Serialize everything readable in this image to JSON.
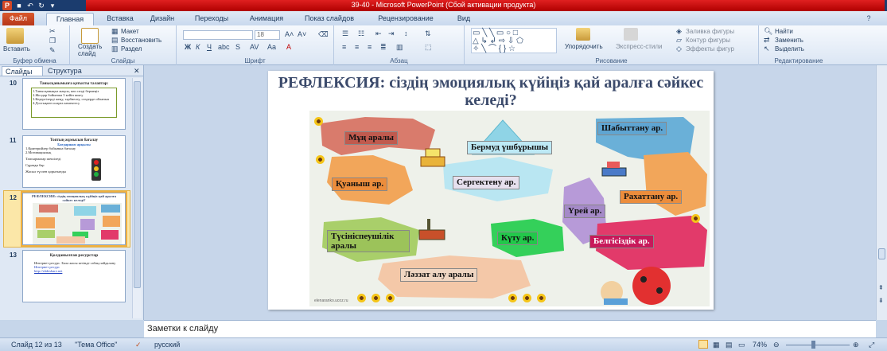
{
  "window": {
    "title": "39-40  -  Microsoft PowerPoint (Сбой активации продукта)"
  },
  "tabs": [
    "Файл",
    "Главная",
    "Вставка",
    "Дизайн",
    "Переходы",
    "Анимация",
    "Показ слайдов",
    "Рецензирование",
    "Вид"
  ],
  "ribbon": {
    "clipboard": {
      "paste": "Вставить",
      "label": "Буфер обмена"
    },
    "slides": {
      "new_slide": "Создать слайд",
      "layout": "Макет",
      "reset": "Восстановить",
      "section": "Раздел",
      "label": "Слайды"
    },
    "font": {
      "size": "18",
      "label": "Шрифт"
    },
    "paragraph": {
      "label": "Абзац"
    },
    "drawing": {
      "arrange": "Упорядочить",
      "quick_styles": "Экспресс-стили",
      "fill": "Заливка фигуры",
      "outline": "Контур фигуры",
      "effects": "Эффекты фигур",
      "label": "Рисование"
    },
    "editing": {
      "find": "Найти",
      "replace": "Заменить",
      "select": "Выделить",
      "label": "Редактирование"
    }
  },
  "panel": {
    "tabs": [
      "Слайды",
      "Структура"
    ],
    "slides": [
      {
        "num": "10",
        "title": "Танысқанымызға қатысты талаптар:",
        "lines": [
          "1.Танысқаныңыз жақсы, көп сөзді бермеңіз",
          "2.Жолдар бойынша 3 кейін шығу",
          "3.Кедергілерді жеңу, тәрбиелеу, сөздерде ойланып",
          "4.Достықпен оларға көмектесу"
        ]
      },
      {
        "num": "11",
        "title": "Топтың жұмысын бағалау",
        "subtitle": "Бағдаршам арқылы",
        "lines": [
          "1.Критерийлер бойынша бағалау",
          "2.Мотивациялық",
          "Тапсырмалар шешіледі",
          "Сұраққа бар",
          "Жасыл түспен қорытынды"
        ]
      },
      {
        "num": "12",
        "title": "РЕФЛЕКСИЯ: сіздің эмоциялық күйіңіз қай аралға сәйкес келеді?"
      },
      {
        "num": "13",
        "title": "Қолданылған ресурстар",
        "lines": [
          "Интернет ресурс. Бала жасы кезінде сабақ пайдалану",
          "Интернет ресурс",
          "http://slideshare.net"
        ]
      }
    ]
  },
  "slide": {
    "title": "РЕФЛЕКСИЯ: сіздің эмоциялық күйіңіз қай аралға сәйкес келеді?",
    "islands": {
      "mun": "Мұң аралы",
      "bermud": "Бермуд үшбұрышы",
      "shabyt": "Шабыттану ар.",
      "quanysh": "Қуаныш ар.",
      "sergek": "Сергектену ар.",
      "rakhat": "Рахаттану ар.",
      "urei": "Үрей ар.",
      "tusinis": "Түсініспеушілік аралы",
      "kutu": "Күту ар.",
      "belgisiz": "Белгісіздік ар.",
      "lyazzat": "Ләззат алу аралы"
    },
    "watermark": "elenaranko.ucoz.ru"
  },
  "colors": {
    "accent": "#c00000",
    "title": "#3b4a6b"
  },
  "notes": {
    "placeholder": "Заметки к слайду"
  },
  "status": {
    "slide_info": "Слайд 12 из 13",
    "theme": "\"Тема Office\"",
    "language": "русский",
    "zoom": "74%"
  }
}
